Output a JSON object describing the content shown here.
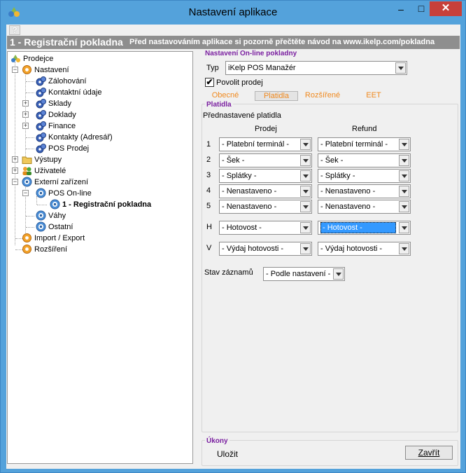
{
  "window": {
    "title": "Nastavení aplikace",
    "minimize_glyph": "–",
    "maximize_glyph": "□",
    "close_glyph": "✕",
    "help_glyph": "?"
  },
  "banner": {
    "title": "1 - Registrační pokladna",
    "note": "Před nastavováním aplikace si pozorně přečtěte návod na www.ikelp.com/pokladna"
  },
  "tree": {
    "root": "Prodejce",
    "nastaveni": "Nastavení",
    "zalohovani": "Zálohování",
    "kontaktni_udaje": "Kontaktní údaje",
    "sklady": "Sklady",
    "doklady": "Doklady",
    "finance": "Finance",
    "kontakty": "Kontakty (Adresář)",
    "pos_prodej": "POS Prodej",
    "vystupy": "Výstupy",
    "uzivatele": "Uživatelé",
    "externi": "Externí zařízení",
    "pos_online": "POS On-line",
    "registracni": "1 - Registrační pokladna",
    "vahy": "Váhy",
    "ostatni": "Ostatní",
    "import_export": "Import / Export",
    "rozsireni": "Rozšíření",
    "expander_plus": "+",
    "expander_minus": "−"
  },
  "online": {
    "group_title": "Nastavení On-line pokladny",
    "typ_label": "Typ",
    "typ_value": "iKelp POS Manažér",
    "povolit_label": "Povolit prodej",
    "povolit_checked": true,
    "check_glyph": "✔"
  },
  "tabs": {
    "obecne": "Obecné",
    "platidla": "Platidla",
    "rozsirene": "Rozšířené",
    "eet": "EET",
    "active": "platidla",
    "color": "#f0891e"
  },
  "platidla": {
    "group_title": "Platidla",
    "heading": "Přednastavené platidla",
    "col_prodej": "Prodej",
    "col_refund": "Refund",
    "rows": [
      {
        "key": "1",
        "prodej": "- Platební terminál -",
        "refund": "- Platební terminál -"
      },
      {
        "key": "2",
        "prodej": "- Šek -",
        "refund": "- Šek -"
      },
      {
        "key": "3",
        "prodej": "- Splátky -",
        "refund": "- Splátky -"
      },
      {
        "key": "4",
        "prodej": "- Nenastaveno -",
        "refund": "- Nenastaveno -"
      },
      {
        "key": "5",
        "prodej": "- Nenastaveno -",
        "refund": "- Nenastaveno -"
      },
      {
        "key": "H",
        "prodej": "- Hotovost -",
        "refund": "- Hotovost -"
      },
      {
        "key": "V",
        "prodej": "- Výdaj hotovosti -",
        "refund": "- Výdaj hotovosti -"
      }
    ],
    "stav_label": "Stav záznamů",
    "stav_value": "- Podle nastavení -"
  },
  "ukony": {
    "group_title": "Úkony",
    "save_label": "Uložit",
    "close_label": "Zavřít"
  },
  "colors": {
    "titlebar": "#54a2db",
    "close_button": "#c7403a",
    "banner": "#8e8e8e",
    "group_title": "#7a1fa0",
    "focus": "#3399ff"
  }
}
